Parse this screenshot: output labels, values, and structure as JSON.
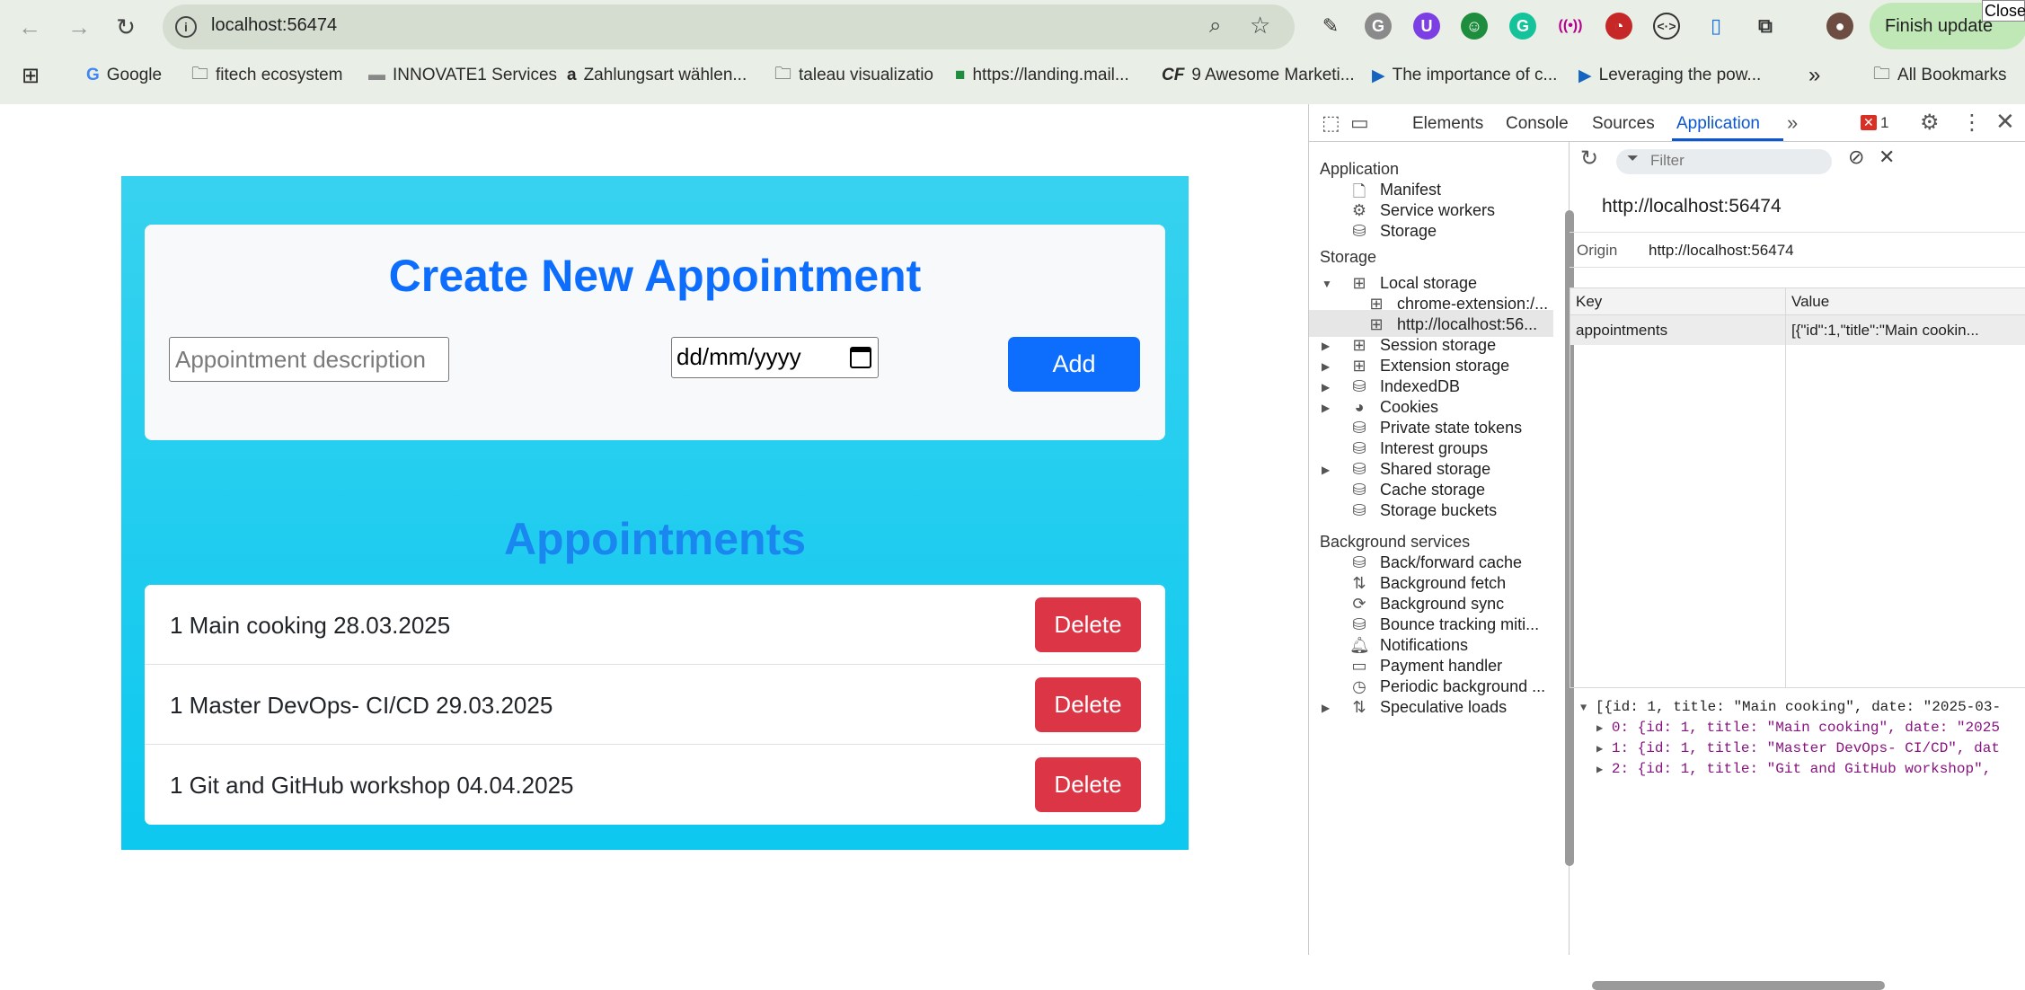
{
  "browser": {
    "url": "localhost:56474",
    "finish_update": "Finish update",
    "close_label": "Close"
  },
  "bookmarks": [
    {
      "label": "Google"
    },
    {
      "label": "fitech ecosystem"
    },
    {
      "label": "INNOVATE1 Services"
    },
    {
      "label": "Zahlungsart wählen..."
    },
    {
      "label": "taleau visualizatio"
    },
    {
      "label": "https://landing.mail..."
    },
    {
      "label": "9 Awesome Marketi..."
    },
    {
      "label": "The importance of c..."
    },
    {
      "label": "Leveraging the pow..."
    },
    {
      "label": "All Bookmarks"
    }
  ],
  "app": {
    "create_title": "Create New Appointment",
    "desc_placeholder": "Appointment description",
    "date_placeholder": "dd/mm/yyyy",
    "add_label": "Add",
    "list_title": "Appointments",
    "delete_label": "Delete",
    "appointments": [
      {
        "text": "1 Main cooking 28.03.2025"
      },
      {
        "text": "1 Master DevOps- CI/CD 29.03.2025"
      },
      {
        "text": "1 Git and GitHub workshop 04.04.2025"
      }
    ]
  },
  "devtools": {
    "tabs": [
      "Elements",
      "Console",
      "Sources",
      "Application"
    ],
    "active_tab": "Application",
    "error_count": "1",
    "sidebar": {
      "application_header": "Application",
      "application_items": [
        "Manifest",
        "Service workers",
        "Storage"
      ],
      "storage_header": "Storage",
      "local_storage": "Local storage",
      "local_children": [
        "chrome-extension:/...",
        "http://localhost:56..."
      ],
      "storage_items": [
        "Session storage",
        "Extension storage",
        "IndexedDB",
        "Cookies",
        "Private state tokens",
        "Interest groups",
        "Shared storage",
        "Cache storage",
        "Storage buckets"
      ],
      "bg_header": "Background services",
      "bg_items": [
        "Back/forward cache",
        "Background fetch",
        "Background sync",
        "Bounce tracking miti...",
        "Notifications",
        "Payment handler",
        "Periodic background ...",
        "Speculative loads"
      ]
    },
    "main": {
      "filter_placeholder": "Filter",
      "origin_heading": "http://localhost:56474",
      "origin_label": "Origin",
      "origin_value": "http://localhost:56474",
      "col_key": "Key",
      "col_value": "Value",
      "row_key": "appointments",
      "row_value": "[{\"id\":1,\"title\":\"Main cookin...",
      "json_lines": [
        "[{id: 1, title: \"Main cooking\", date: \"2025-03-",
        "0: {id: 1, title: \"Main cooking\", date: \"2025",
        "1: {id: 1, title: \"Master DevOps- CI/CD\", dat",
        "2: {id: 1, title: \"Git and GitHub workshop\","
      ]
    }
  }
}
